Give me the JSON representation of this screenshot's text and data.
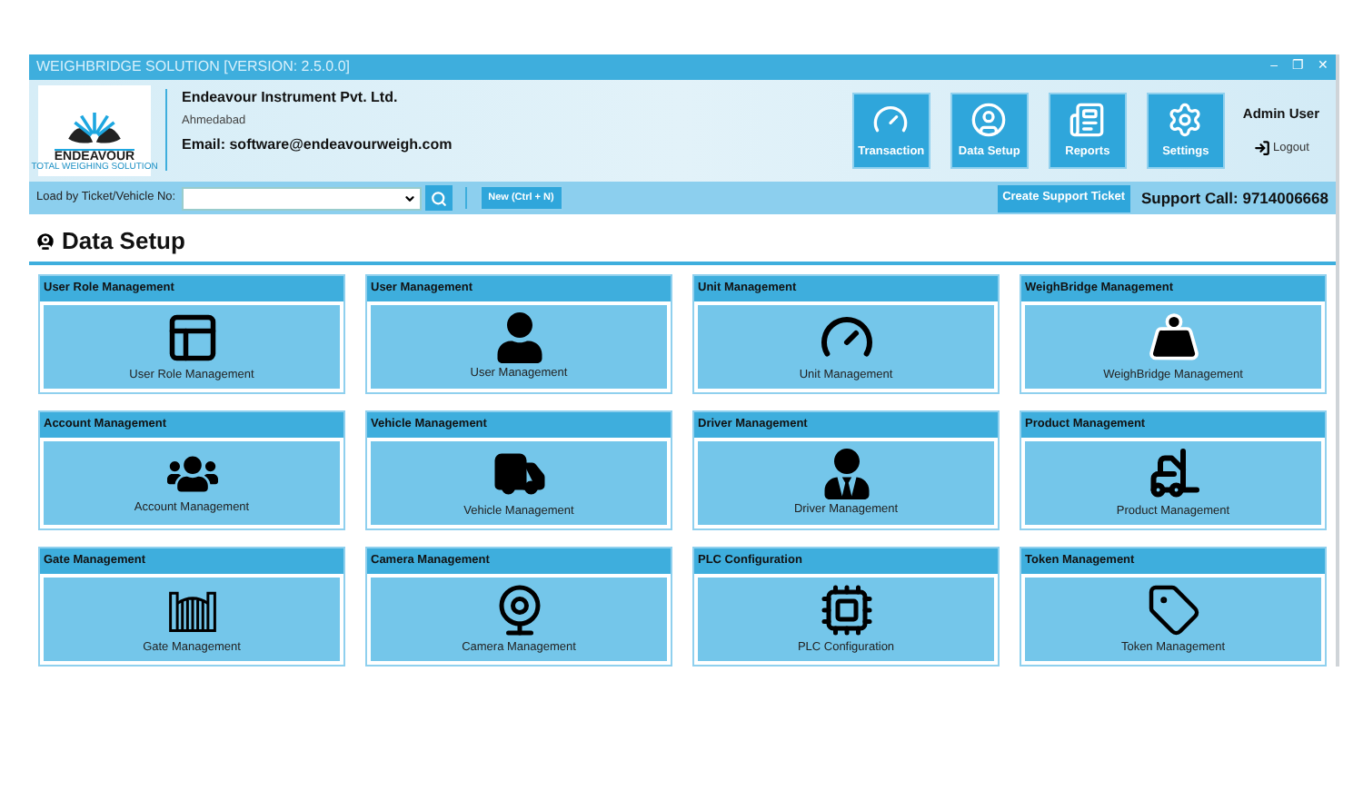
{
  "window": {
    "title": "WEIGHBRIDGE SOLUTION [VERSION: 2.5.0.0]",
    "controls": [
      "–",
      "❐",
      "✕"
    ]
  },
  "logo": {
    "name": "ENDEAVOUR",
    "tagline": "TOTAL WEIGHING SOLUTION"
  },
  "company": {
    "name": "Endeavour Instrument Pvt. Ltd.",
    "city": "Ahmedabad",
    "email": "Email: software@endeavourweigh.com"
  },
  "nav": [
    {
      "label": "Transaction",
      "kind": "gauge"
    },
    {
      "label": "Data Setup",
      "kind": "user"
    },
    {
      "label": "Reports",
      "kind": "report"
    },
    {
      "label": "Settings",
      "kind": "gear"
    }
  ],
  "user": {
    "name": "Admin User",
    "logout": "Logout"
  },
  "toolbar": {
    "search_label": "Load by Ticket/Vehicle No:",
    "new_button": "New (Ctrl + N)",
    "support_button": "Create Support Ticket",
    "support_call": "Support Call: 9714006668"
  },
  "page_title": "Data Setup",
  "tiles": [
    {
      "header": "User Role Management",
      "label": "User Role Management",
      "kind": "layout"
    },
    {
      "header": "User Management",
      "label": "User Management",
      "kind": "user"
    },
    {
      "header": "Unit Management",
      "label": "Unit Management",
      "kind": "gauge"
    },
    {
      "header": "WeighBridge Management",
      "label": "WeighBridge Management",
      "kind": "weight"
    },
    {
      "header": "Account Management",
      "label": "Account Management",
      "kind": "users"
    },
    {
      "header": "Vehicle Management",
      "label": "Vehicle Management",
      "kind": "truck"
    },
    {
      "header": "Driver Management",
      "label": "Driver Management",
      "kind": "driver"
    },
    {
      "header": "Product Management",
      "label": "Product Management",
      "kind": "forklift"
    },
    {
      "header": "Gate Management",
      "label": "Gate Management",
      "kind": "gate"
    },
    {
      "header": "Camera Management",
      "label": "Camera Management",
      "kind": "webcam"
    },
    {
      "header": "PLC Configuration",
      "label": "PLC Configuration",
      "kind": "chip"
    },
    {
      "header": "Token Management",
      "label": "Token Management",
      "kind": "tag"
    }
  ]
}
